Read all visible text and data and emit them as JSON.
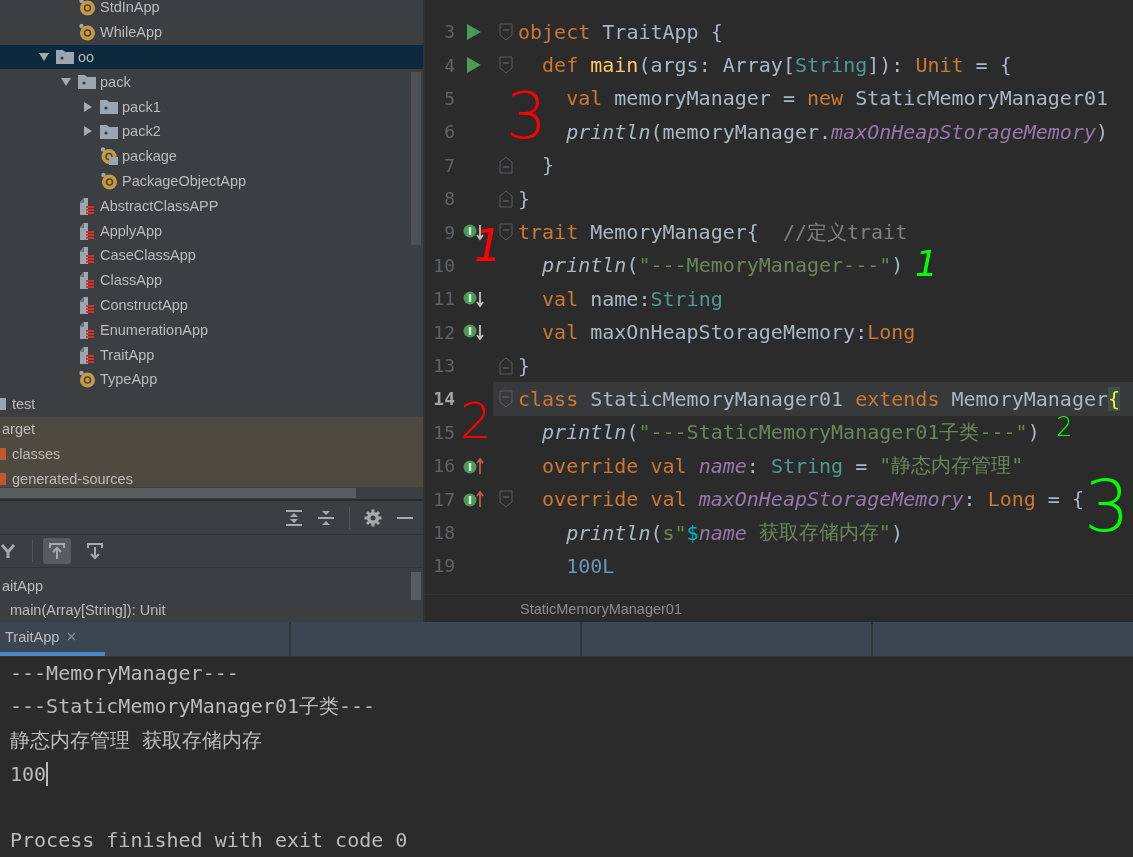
{
  "tree": [
    {
      "children": [
        {
          "children": [
            {
              "children": [
                {
                  "children": [
                    {
                      "children": [
                        {
                          "label": "StdInApp",
                          "kind": "object",
                          "selected": false,
                          "excluded": false
                        },
                        {
                          "label": "WhileApp",
                          "kind": "object",
                          "selected": false,
                          "excluded": false
                        }
                      ]
                    },
                    {
                      "label": "oo",
                      "kind": "package",
                      "expanded": true,
                      "selected": true,
                      "excluded": false,
                      "children": [
                        {
                          "label": "pack",
                          "kind": "package",
                          "expanded": true,
                          "selected": false,
                          "excluded": false,
                          "children": [
                            {
                              "label": "pack1",
                              "kind": "package",
                              "expanded": false,
                              "selected": false,
                              "excluded": false
                            },
                            {
                              "label": "pack2",
                              "kind": "package",
                              "expanded": false,
                              "selected": false,
                              "excluded": false
                            },
                            {
                              "label": "package",
                              "kind": "package-object",
                              "selected": false,
                              "excluded": false
                            },
                            {
                              "label": "PackageObjectApp",
                              "kind": "object",
                              "selected": false,
                              "excluded": false
                            }
                          ]
                        },
                        {
                          "label": "AbstractClassAPP",
                          "kind": "class-file",
                          "selected": false,
                          "excluded": false
                        },
                        {
                          "label": "ApplyApp",
                          "kind": "class-file",
                          "selected": false,
                          "excluded": false
                        },
                        {
                          "label": "CaseClassApp",
                          "kind": "class-file",
                          "selected": false,
                          "excluded": false
                        },
                        {
                          "label": "ClassApp",
                          "kind": "class-file",
                          "selected": false,
                          "excluded": false
                        },
                        {
                          "label": "ConstructApp",
                          "kind": "class-file",
                          "selected": false,
                          "excluded": false
                        },
                        {
                          "label": "EnumerationApp",
                          "kind": "class-file",
                          "selected": false,
                          "excluded": false
                        },
                        {
                          "label": "TraitApp",
                          "kind": "class-file",
                          "selected": false,
                          "excluded": false
                        },
                        {
                          "label": "TypeApp",
                          "kind": "object",
                          "selected": false,
                          "excluded": false
                        }
                      ]
                    }
                  ]
                }
              ]
            }
          ]
        },
        {
          "label": "test",
          "kind": "folder",
          "selected": false,
          "excluded": false
        }
      ]
    },
    {
      "label": "arget",
      "selected": false,
      "excluded": true,
      "children": [
        {
          "label": "classes",
          "kind": "excluded-folder",
          "selected": false,
          "excluded": true
        },
        {
          "label": "generated-sources",
          "kind": "excluded-folder",
          "selected": false,
          "excluded": true
        }
      ]
    }
  ],
  "structure": {
    "toolbar": [
      {
        "kind": "fork",
        "selected": false
      },
      {
        "kind": "arrow-up-to-bar",
        "selected": true
      },
      {
        "kind": "arrow-down-from-bar",
        "selected": false
      }
    ],
    "items": [
      "aitApp",
      "main(Array[String]): Unit"
    ]
  },
  "editor": {
    "lines": [
      {
        "number": "3",
        "gutter": {
          "kind": "run"
        },
        "fold": {
          "kind": "start"
        },
        "current": false,
        "tokens": [
          {
            "text": "object ",
            "kind": "keyword"
          },
          {
            "text": "TraitApp {",
            "kind": "plain"
          }
        ]
      },
      {
        "number": "4",
        "gutter": {
          "kind": "run"
        },
        "fold": {
          "kind": "start"
        },
        "current": false,
        "tokens": [
          {
            "text": "  def ",
            "kind": "keyword"
          },
          {
            "text": "main",
            "kind": "function"
          },
          {
            "text": "(args: Array[",
            "kind": "plain"
          },
          {
            "text": "String",
            "kind": "type"
          },
          {
            "text": "]): ",
            "kind": "plain"
          },
          {
            "text": "Unit",
            "kind": "keyword"
          },
          {
            "text": " = {",
            "kind": "plain"
          }
        ]
      },
      {
        "number": "5",
        "current": false,
        "tokens": [
          {
            "text": "    val ",
            "kind": "keyword"
          },
          {
            "text": "memoryManager = ",
            "kind": "plain"
          },
          {
            "text": "new ",
            "kind": "keyword"
          },
          {
            "text": "StaticMemoryManager01",
            "kind": "plain"
          }
        ]
      },
      {
        "number": "6",
        "current": false,
        "tokens": [
          {
            "text": "    println",
            "kind": "call"
          },
          {
            "text": "(memoryManager.",
            "kind": "plain"
          },
          {
            "text": "maxOnHeapStorageMemory",
            "kind": "field"
          },
          {
            "text": ")",
            "kind": "plain"
          }
        ]
      },
      {
        "number": "7",
        "fold": {
          "kind": "end"
        },
        "current": false,
        "tokens": [
          {
            "text": "  }",
            "kind": "plain"
          }
        ]
      },
      {
        "number": "8",
        "fold": {
          "kind": "end"
        },
        "current": false,
        "tokens": [
          {
            "text": "}",
            "kind": "plain"
          }
        ]
      },
      {
        "number": "9",
        "gutter": {
          "kind": "implemented"
        },
        "fold": {
          "kind": "start"
        },
        "current": false,
        "tokens": [
          {
            "text": "trait ",
            "kind": "keyword"
          },
          {
            "text": "MemoryManager{  ",
            "kind": "plain"
          },
          {
            "text": "//定义trait",
            "kind": "comment"
          }
        ]
      },
      {
        "number": "10",
        "current": false,
        "tokens": [
          {
            "text": "  println",
            "kind": "call"
          },
          {
            "text": "(",
            "kind": "plain"
          },
          {
            "text": "\"---MemoryManager---\"",
            "kind": "string"
          },
          {
            "text": ")",
            "kind": "plain"
          }
        ]
      },
      {
        "number": "11",
        "gutter": {
          "kind": "implemented"
        },
        "current": false,
        "tokens": [
          {
            "text": "  val ",
            "kind": "keyword"
          },
          {
            "text": "name:",
            "kind": "plain"
          },
          {
            "text": "String",
            "kind": "type"
          }
        ]
      },
      {
        "number": "12",
        "gutter": {
          "kind": "implemented"
        },
        "current": false,
        "tokens": [
          {
            "text": "  val ",
            "kind": "keyword"
          },
          {
            "text": "maxOnHeapStorageMemory:",
            "kind": "plain"
          },
          {
            "text": "Long",
            "kind": "keyword"
          }
        ]
      },
      {
        "number": "13",
        "fold": {
          "kind": "end"
        },
        "current": false,
        "tokens": [
          {
            "text": "}",
            "kind": "plain"
          }
        ]
      },
      {
        "number": "14",
        "fold": {
          "kind": "start"
        },
        "current": true,
        "tokens": [
          {
            "text": "class ",
            "kind": "keyword"
          },
          {
            "text": "StaticMemoryManager01 ",
            "kind": "plain"
          },
          {
            "text": "extends ",
            "kind": "keyword"
          },
          {
            "text": "MemoryManager",
            "kind": "plain"
          },
          {
            "text": "{",
            "kind": "brace-match"
          }
        ]
      },
      {
        "number": "15",
        "current": false,
        "tokens": [
          {
            "text": "  println",
            "kind": "call"
          },
          {
            "text": "(",
            "kind": "plain"
          },
          {
            "text": "\"---StaticMemoryManager01子类---\"",
            "kind": "string"
          },
          {
            "text": ")",
            "kind": "plain"
          }
        ]
      },
      {
        "number": "16",
        "gutter": {
          "kind": "overrides"
        },
        "current": false,
        "tokens": [
          {
            "text": "  override val ",
            "kind": "keyword"
          },
          {
            "text": "name",
            "kind": "field"
          },
          {
            "text": ": ",
            "kind": "plain"
          },
          {
            "text": "String",
            "kind": "type"
          },
          {
            "text": " = ",
            "kind": "plain"
          },
          {
            "text": "\"静态内存管理\"",
            "kind": "string"
          }
        ]
      },
      {
        "number": "17",
        "gutter": {
          "kind": "overrides"
        },
        "fold": {
          "kind": "start"
        },
        "current": false,
        "tokens": [
          {
            "text": "  override val ",
            "kind": "keyword"
          },
          {
            "text": "maxOnHeapStorageMemory",
            "kind": "field"
          },
          {
            "text": ": ",
            "kind": "plain"
          },
          {
            "text": "Long",
            "kind": "keyword"
          },
          {
            "text": " = {",
            "kind": "plain"
          }
        ]
      },
      {
        "number": "18",
        "current": false,
        "tokens": [
          {
            "text": "    println",
            "kind": "call"
          },
          {
            "text": "(",
            "kind": "plain"
          },
          {
            "text": "s\"",
            "kind": "string"
          },
          {
            "text": "$",
            "kind": "interpolation"
          },
          {
            "text": "name",
            "kind": "field"
          },
          {
            "text": " 获取存储内存\"",
            "kind": "string"
          },
          {
            "text": ")",
            "kind": "plain"
          }
        ]
      },
      {
        "number": "19",
        "current": false,
        "tokens": [
          {
            "text": "    100L",
            "kind": "number"
          }
        ]
      }
    ],
    "breadcrumb": "StaticMemoryManager01"
  },
  "annotations": [
    {
      "text": "3",
      "color": "#ff0000"
    },
    {
      "text": "1",
      "color": "#ff0000"
    },
    {
      "text": "1",
      "color": "#00ff00"
    },
    {
      "text": "2",
      "color": "#ff0000"
    },
    {
      "text": "2",
      "color": "#00ff00"
    },
    {
      "text": "3",
      "color": "#00ff00"
    }
  ],
  "run_tabs": [
    {
      "label": "TraitApp",
      "selected": true
    }
  ],
  "console": {
    "lines": [
      {
        "text": "---MemoryManager---",
        "cursor": false
      },
      {
        "text": "---StaticMemoryManager01子类---",
        "cursor": false
      },
      {
        "text": "静态内存管理 获取存储内存",
        "cursor": false
      },
      {
        "text": "100",
        "cursor": true
      }
    ],
    "exit_message": "Process finished with exit code 0"
  }
}
